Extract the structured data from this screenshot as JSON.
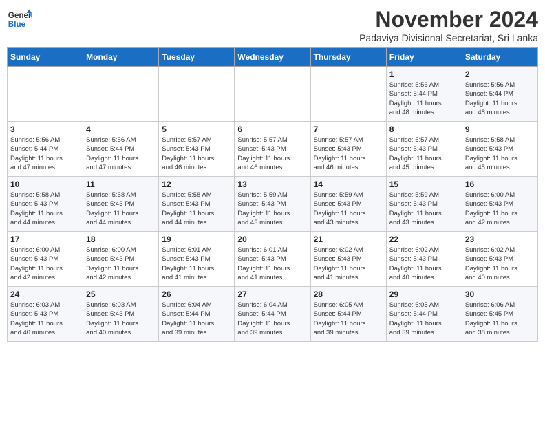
{
  "logo": {
    "general": "General",
    "blue": "Blue"
  },
  "title": "November 2024",
  "subtitle": "Padaviya Divisional Secretariat, Sri Lanka",
  "days_of_week": [
    "Sunday",
    "Monday",
    "Tuesday",
    "Wednesday",
    "Thursday",
    "Friday",
    "Saturday"
  ],
  "weeks": [
    [
      {
        "day": "",
        "info": ""
      },
      {
        "day": "",
        "info": ""
      },
      {
        "day": "",
        "info": ""
      },
      {
        "day": "",
        "info": ""
      },
      {
        "day": "",
        "info": ""
      },
      {
        "day": "1",
        "info": "Sunrise: 5:56 AM\nSunset: 5:44 PM\nDaylight: 11 hours\nand 48 minutes."
      },
      {
        "day": "2",
        "info": "Sunrise: 5:56 AM\nSunset: 5:44 PM\nDaylight: 11 hours\nand 48 minutes."
      }
    ],
    [
      {
        "day": "3",
        "info": "Sunrise: 5:56 AM\nSunset: 5:44 PM\nDaylight: 11 hours\nand 47 minutes."
      },
      {
        "day": "4",
        "info": "Sunrise: 5:56 AM\nSunset: 5:44 PM\nDaylight: 11 hours\nand 47 minutes."
      },
      {
        "day": "5",
        "info": "Sunrise: 5:57 AM\nSunset: 5:43 PM\nDaylight: 11 hours\nand 46 minutes."
      },
      {
        "day": "6",
        "info": "Sunrise: 5:57 AM\nSunset: 5:43 PM\nDaylight: 11 hours\nand 46 minutes."
      },
      {
        "day": "7",
        "info": "Sunrise: 5:57 AM\nSunset: 5:43 PM\nDaylight: 11 hours\nand 46 minutes."
      },
      {
        "day": "8",
        "info": "Sunrise: 5:57 AM\nSunset: 5:43 PM\nDaylight: 11 hours\nand 45 minutes."
      },
      {
        "day": "9",
        "info": "Sunrise: 5:58 AM\nSunset: 5:43 PM\nDaylight: 11 hours\nand 45 minutes."
      }
    ],
    [
      {
        "day": "10",
        "info": "Sunrise: 5:58 AM\nSunset: 5:43 PM\nDaylight: 11 hours\nand 44 minutes."
      },
      {
        "day": "11",
        "info": "Sunrise: 5:58 AM\nSunset: 5:43 PM\nDaylight: 11 hours\nand 44 minutes."
      },
      {
        "day": "12",
        "info": "Sunrise: 5:58 AM\nSunset: 5:43 PM\nDaylight: 11 hours\nand 44 minutes."
      },
      {
        "day": "13",
        "info": "Sunrise: 5:59 AM\nSunset: 5:43 PM\nDaylight: 11 hours\nand 43 minutes."
      },
      {
        "day": "14",
        "info": "Sunrise: 5:59 AM\nSunset: 5:43 PM\nDaylight: 11 hours\nand 43 minutes."
      },
      {
        "day": "15",
        "info": "Sunrise: 5:59 AM\nSunset: 5:43 PM\nDaylight: 11 hours\nand 43 minutes."
      },
      {
        "day": "16",
        "info": "Sunrise: 6:00 AM\nSunset: 5:43 PM\nDaylight: 11 hours\nand 42 minutes."
      }
    ],
    [
      {
        "day": "17",
        "info": "Sunrise: 6:00 AM\nSunset: 5:43 PM\nDaylight: 11 hours\nand 42 minutes."
      },
      {
        "day": "18",
        "info": "Sunrise: 6:00 AM\nSunset: 5:43 PM\nDaylight: 11 hours\nand 42 minutes."
      },
      {
        "day": "19",
        "info": "Sunrise: 6:01 AM\nSunset: 5:43 PM\nDaylight: 11 hours\nand 41 minutes."
      },
      {
        "day": "20",
        "info": "Sunrise: 6:01 AM\nSunset: 5:43 PM\nDaylight: 11 hours\nand 41 minutes."
      },
      {
        "day": "21",
        "info": "Sunrise: 6:02 AM\nSunset: 5:43 PM\nDaylight: 11 hours\nand 41 minutes."
      },
      {
        "day": "22",
        "info": "Sunrise: 6:02 AM\nSunset: 5:43 PM\nDaylight: 11 hours\nand 40 minutes."
      },
      {
        "day": "23",
        "info": "Sunrise: 6:02 AM\nSunset: 5:43 PM\nDaylight: 11 hours\nand 40 minutes."
      }
    ],
    [
      {
        "day": "24",
        "info": "Sunrise: 6:03 AM\nSunset: 5:43 PM\nDaylight: 11 hours\nand 40 minutes."
      },
      {
        "day": "25",
        "info": "Sunrise: 6:03 AM\nSunset: 5:43 PM\nDaylight: 11 hours\nand 40 minutes."
      },
      {
        "day": "26",
        "info": "Sunrise: 6:04 AM\nSunset: 5:44 PM\nDaylight: 11 hours\nand 39 minutes."
      },
      {
        "day": "27",
        "info": "Sunrise: 6:04 AM\nSunset: 5:44 PM\nDaylight: 11 hours\nand 39 minutes."
      },
      {
        "day": "28",
        "info": "Sunrise: 6:05 AM\nSunset: 5:44 PM\nDaylight: 11 hours\nand 39 minutes."
      },
      {
        "day": "29",
        "info": "Sunrise: 6:05 AM\nSunset: 5:44 PM\nDaylight: 11 hours\nand 39 minutes."
      },
      {
        "day": "30",
        "info": "Sunrise: 6:06 AM\nSunset: 5:45 PM\nDaylight: 11 hours\nand 38 minutes."
      }
    ]
  ]
}
